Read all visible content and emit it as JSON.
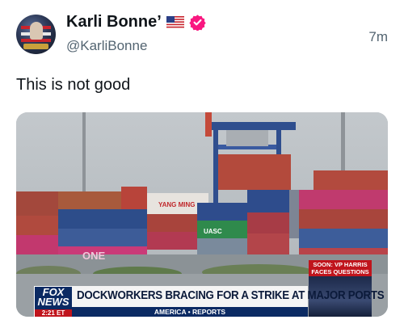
{
  "author": {
    "display_name": "Karli Bonne’",
    "handle": "@KarliBonne",
    "avatar_icon": "profile-avatar",
    "badges": [
      "us-flag-icon",
      "verified-badge-icon"
    ],
    "verified_color": "#f91880"
  },
  "tweet": {
    "time": "7m",
    "text": "This is not good"
  },
  "media": {
    "news_logo": "FOX NEWS",
    "news_time": "2:21 ET",
    "headline": "DOCKWORKERS BRACING FOR A STRIKE AT MAJOR PORTS",
    "show_name": "AMERICA • REPORTS",
    "soon_label": "SOON: VP HARRIS FACES QUESTIONS",
    "container_labels": [
      "YANG MING",
      "UASC",
      "ONE"
    ]
  }
}
